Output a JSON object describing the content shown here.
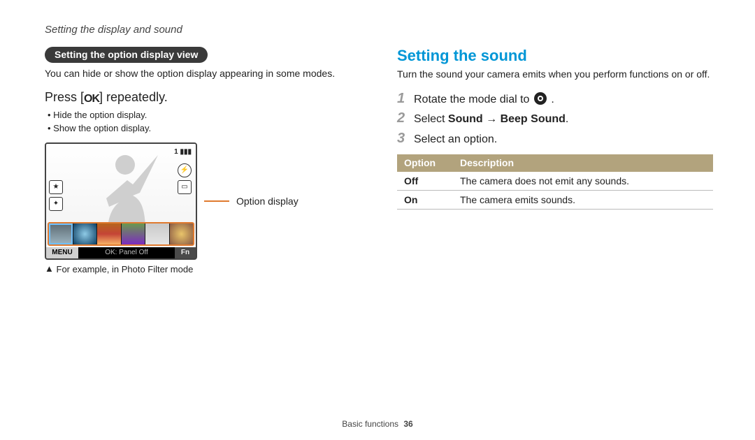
{
  "breadcrumb": "Setting the display and sound",
  "left": {
    "pill": "Setting the option display view",
    "intro": "You can hide or show the option display appearing in some modes.",
    "press_prefix": "Press [",
    "press_key": "OK",
    "press_suffix": "] repeatedly.",
    "bullets": [
      "Hide the option display.",
      "Show the option display."
    ],
    "lcd": {
      "indicator": "1",
      "menu": "MENU",
      "panel_off": "OK: Panel Off",
      "fn": "Fn"
    },
    "lead_label": "Option display",
    "caption_marker": "▲",
    "caption": "For example, in Photo Filter mode"
  },
  "right": {
    "heading": "Setting the sound",
    "intro": "Turn the sound your camera emits when you perform functions on or off.",
    "steps": [
      {
        "num": "1",
        "text_pre": "Rotate the mode dial to ",
        "text_post": " ."
      },
      {
        "num": "2",
        "text_pre": "Select ",
        "bold1": "Sound",
        "arrow": " → ",
        "bold2": "Beep Sound",
        "text_post": "."
      },
      {
        "num": "3",
        "text_pre": "Select an option."
      }
    ],
    "table": {
      "h1": "Option",
      "h2": "Description",
      "rows": [
        {
          "opt": "Off",
          "desc": "The camera does not emit any sounds."
        },
        {
          "opt": "On",
          "desc": "The camera emits sounds."
        }
      ]
    }
  },
  "footer": {
    "section": "Basic functions",
    "page": "36"
  }
}
